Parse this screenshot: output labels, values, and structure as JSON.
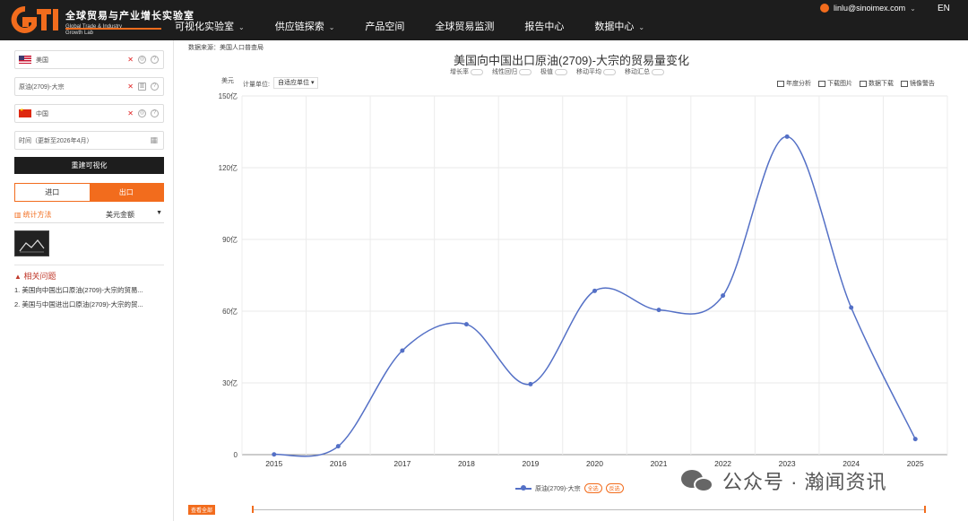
{
  "header": {
    "logo_title": "全球贸易与产业增长实验室",
    "logo_sub1": "Global Trade & Industry",
    "logo_sub2": "Growth Lab",
    "nav": [
      {
        "label": "可视化实验室",
        "dropdown": true
      },
      {
        "label": "供应链探索",
        "dropdown": true
      },
      {
        "label": "产品空间",
        "dropdown": false
      },
      {
        "label": "全球贸易监测",
        "dropdown": false
      },
      {
        "label": "报告中心",
        "dropdown": false
      },
      {
        "label": "数据中心",
        "dropdown": true
      }
    ],
    "user": "linlu@sinoimex.com",
    "lang": "EN",
    "accent": "#f26c1d"
  },
  "sidebar": {
    "reporter": "美国",
    "product": "原油(2709)-大宗",
    "partner": "中国",
    "time": "时间（更新至2026年4月）",
    "rebuild": "重建可视化",
    "import": "进口",
    "export": "出口",
    "stat_label": "统计方法",
    "stat_value": "美元金额",
    "related_title": "相关问题",
    "related": [
      "1. 美国向中国出口原油(2709)-大宗的贸易...",
      "2. 美国与中国进出口原油(2709)-大宗的贸..."
    ]
  },
  "main": {
    "source": "数据来源：美国人口普查局",
    "title": "美国向中国出口原油(2709)-大宗的贸易量变化",
    "options": [
      "增长率",
      "线性回归",
      "极值",
      "移动平均",
      "移动汇总"
    ],
    "unit": "美元",
    "unit_label": "计量单位:",
    "unit_select": "自适应单位 ▾",
    "tools": [
      "年度分析",
      "下载图片",
      "数据下载",
      "镜像警告"
    ],
    "legend_name": "原油(2709)-大宗",
    "legend_all": "全选",
    "legend_invert": "反选",
    "view_all": "查看全部",
    "watermark": "公众号 · 瀚闻资讯"
  },
  "chart_data": {
    "type": "line",
    "smooth": true,
    "color": "#5470c6",
    "categories": [
      "2015",
      "2016",
      "2017",
      "2018",
      "2019",
      "2020",
      "2021",
      "2022",
      "2023",
      "2024",
      "2025"
    ],
    "series": [
      {
        "name": "原油(2709)-大宗",
        "values": [
          0.1,
          3.5,
          43.5,
          54.5,
          29.5,
          68.5,
          60.5,
          66.5,
          133,
          61.5,
          6.5
        ]
      }
    ],
    "ylim": [
      0,
      150
    ],
    "yticks": [
      0,
      30,
      60,
      90,
      120,
      150
    ],
    "ytick_labels": [
      "0",
      "30亿",
      "60亿",
      "90亿",
      "120亿",
      "150亿"
    ],
    "grid": true
  }
}
